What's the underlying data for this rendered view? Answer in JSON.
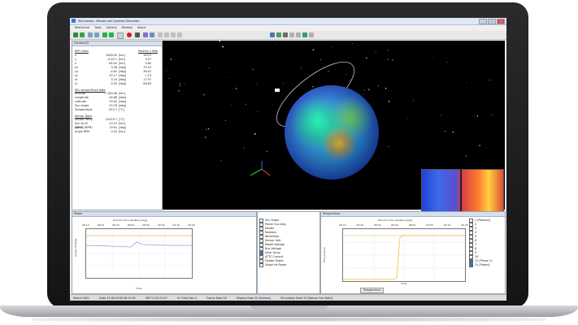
{
  "window": {
    "title": "StkCelestia - Mission and Systems Simulator"
  },
  "menu": [
    "NetControl",
    "Tools",
    "Options",
    "Window",
    "About"
  ],
  "left_panel": {
    "header": "Camera ID",
    "col_head_left": "REF Index",
    "col_head_right": "Params 1.0Ma",
    "rows": [
      {
        "l": "x",
        "v": "1456.45",
        "u": "[km]",
        "v2": "-8079"
      },
      {
        "l": "y",
        "v": "-0.40 1",
        "u": "[km]",
        "v2": "3.07"
      },
      {
        "l": "z",
        "v": "84.05",
        "u": "[km]",
        "v2": "0.80"
      },
      {
        "l": "vx",
        "v": "3.28",
        "u": "[deg]",
        "v2": "75.14"
      },
      {
        "l": "vy",
        "v": "-4.62",
        "u": "[deg]",
        "v2": "36.42"
      },
      {
        "l": "vz",
        "v": "-15.17",
        "u": "[deg]",
        "v2": "1.13"
      },
      {
        "l": "rx",
        "v": "3.24",
        "u": "[deg]",
        "v2": "17.97"
      },
      {
        "l": "ry",
        "v": "0.05",
        "u": "[deg]",
        "v2": "68.83"
      }
    ],
    "sect2": "REL sensor/Track data",
    "rows2": [
      {
        "l": "Altitude",
        "v": "1 145.06",
        "u": "[km]"
      },
      {
        "l": "Longitude",
        "v": "44.88",
        "u": "[deg]"
      },
      {
        "l": "Latitude",
        "v": "19.42",
        "u": "[deg]"
      },
      {
        "l": "Sun Angle",
        "v": "25.76",
        "u": "[deg]"
      },
      {
        "l": "Temperature",
        "v": "612.7",
        "u": "[°C]"
      }
    ],
    "sect3": "Sensor Data",
    "rows3": [
      {
        "l": "Sensor Temp",
        "v": "-12019.7",
        "u": "[°C]"
      },
      {
        "l": "Sun Av El (RPM)",
        "v": "20.15",
        "u": "[km]"
      },
      {
        "l": "Sun El (RPM)",
        "v": "19.61",
        "u": "[deg]"
      },
      {
        "l": "Angle RPM",
        "v": "0.10",
        "u": "[km]"
      }
    ]
  },
  "plot1": {
    "header": "Power",
    "title": "Remote Time Variable [deg]",
    "ylabel": "Sensor Voltage",
    "xlabel": "Time",
    "ticks": [
      "08:10",
      "08:20",
      "08:30",
      "08:40",
      "08:50",
      "09:00",
      "09:10",
      "09:20"
    ]
  },
  "popup": [
    "Thermal",
    "Attitude",
    "Temperature"
  ],
  "legend_list": [
    "Sun Angle",
    "Power Sun Ang",
    "Heater",
    "Radiator",
    "WheelSpd",
    "Sensor Volt",
    "Model Voltage",
    "Bus Voltage",
    "Solar Array",
    "ATTC Current",
    "Heater Power",
    "Stage Int Power"
  ],
  "plot2": {
    "header": "Temperature",
    "title": "Remote Time Variable [deg]",
    "ylabel": "Temperature",
    "xlabel": "Time",
    "ticks": [
      "08:10",
      "08:20",
      "08:30",
      "08:40",
      "08:50",
      "09:00",
      "09:10",
      "09:20"
    ],
    "tab": "Temperature"
  },
  "right_list": [
    "1 [Position]",
    "2",
    "3",
    "4",
    "5",
    "6",
    "7",
    "8",
    "9",
    "10",
    "11 [Phase 1]",
    "12 [Power]"
  ],
  "status": [
    "Select 0001",
    "Date 15.06.2008 08:25:41",
    "MET 0:02:21:07",
    "Sc Orbit Rev 4",
    "Frame Rate 20",
    "Display Rate 20 [frames]",
    "Simulation Rate 20 [Nature Sim Rate]"
  ]
}
